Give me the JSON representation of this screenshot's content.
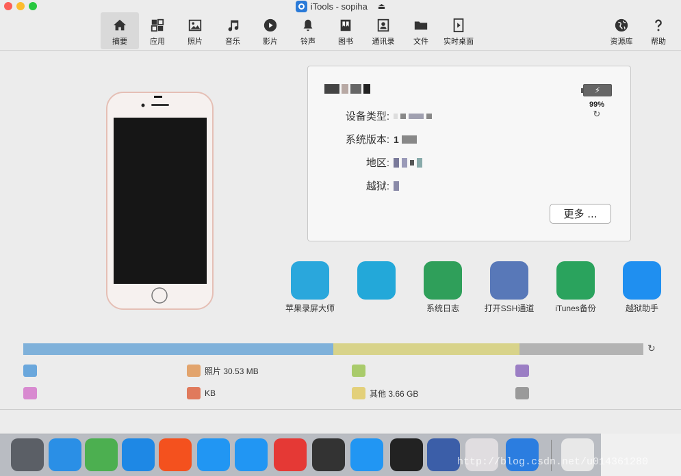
{
  "window": {
    "title": "iTools - sopiha"
  },
  "toolbar": {
    "items": [
      {
        "label": "摘要",
        "icon": "home-icon",
        "active": true
      },
      {
        "label": "应用",
        "icon": "apps-icon",
        "active": false
      },
      {
        "label": "照片",
        "icon": "photo-icon",
        "active": false
      },
      {
        "label": "音乐",
        "icon": "music-icon",
        "active": false
      },
      {
        "label": "影片",
        "icon": "play-icon",
        "active": false
      },
      {
        "label": "铃声",
        "icon": "bell-icon",
        "active": false
      },
      {
        "label": "图书",
        "icon": "book-icon",
        "active": false
      },
      {
        "label": "通讯录",
        "icon": "contacts-icon",
        "active": false
      },
      {
        "label": "文件",
        "icon": "folder-icon",
        "active": false
      },
      {
        "label": "实时桌面",
        "icon": "screen-icon",
        "active": false
      }
    ],
    "right_items": [
      {
        "label": "资源库",
        "icon": "globe-icon"
      },
      {
        "label": "帮助",
        "icon": "help-icon"
      }
    ]
  },
  "device": {
    "fields": [
      {
        "label": "设备类型:",
        "value": ""
      },
      {
        "label": "系统版本:",
        "value": "1"
      },
      {
        "label": "地区:",
        "value": ""
      },
      {
        "label": "越狱:",
        "value": ""
      }
    ],
    "battery_percent": "99%",
    "more_button": "更多 ..."
  },
  "tools": [
    {
      "label": "苹果录屏大师",
      "color": "#2aa7dc"
    },
    {
      "label": "",
      "color": "#23a8d9"
    },
    {
      "label": "系统日志",
      "color": "#2f9f5a"
    },
    {
      "label": "打开SSH通道",
      "color": "#5878b8"
    },
    {
      "label": "iTunes备份",
      "color": "#2aa35d"
    },
    {
      "label": "越狱助手",
      "color": "#1f8ff0"
    }
  ],
  "storage": {
    "segments": [
      {
        "name": "blue",
        "fraction": 0.5,
        "color": "#7fb1da"
      },
      {
        "name": "yellow",
        "fraction": 0.3,
        "color": "#d8d38a"
      },
      {
        "name": "gray",
        "fraction": 0.2,
        "color": "#b3b3b3"
      }
    ],
    "legend": [
      {
        "text": "",
        "color": "#6aa7dc"
      },
      {
        "text": "照片 30.53 MB",
        "color": "#e2a46d"
      },
      {
        "text": "",
        "color": "#a9cb6b"
      },
      {
        "text": "",
        "color": "#9b7ec4"
      },
      {
        "text": "",
        "color": "#d88ad0"
      },
      {
        "text": "KB",
        "color": "#e07a5c"
      },
      {
        "text": "其他 3.66 GB",
        "color": "#e3d07a"
      },
      {
        "text": "",
        "color": "#9a9a9a"
      }
    ]
  },
  "watermark": "http://blog.csdn.net/u014361280",
  "dock": {
    "colors": [
      "#5b5f66",
      "#2a8fe6",
      "#4caf50",
      "#1e88e5",
      "#f4511e",
      "#2196f3",
      "#2196f3",
      "#e53935",
      "#333333",
      "#2196f3",
      "#222222",
      "#3b5ea8",
      "#e0dde0",
      "#2b7de0"
    ]
  }
}
